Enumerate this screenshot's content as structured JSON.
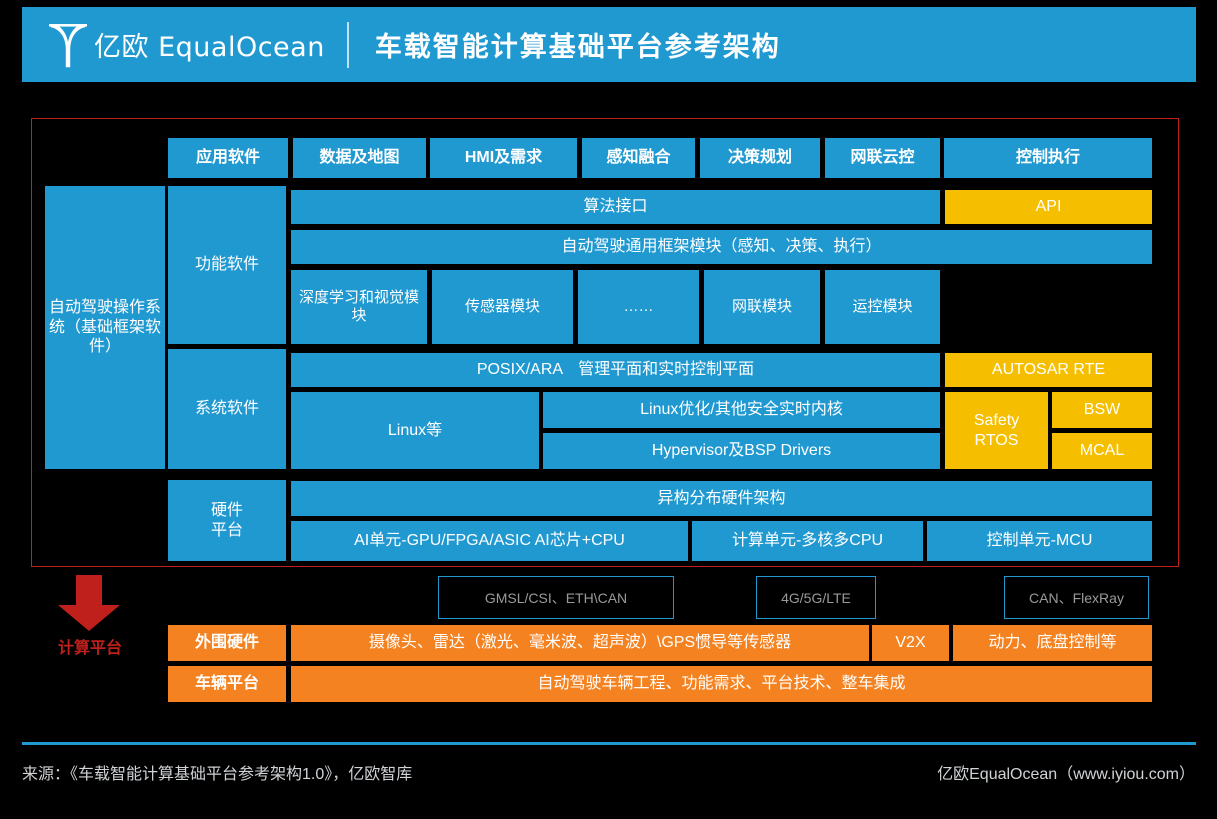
{
  "header": {
    "logo_text": "亿欧 EqualOcean",
    "logo_icon": "equalocean-leaf-logo",
    "title": "车载智能计算基础平台参考架构"
  },
  "top_row": [
    {
      "label": "应用软件"
    },
    {
      "label": "数据及地图"
    },
    {
      "label": "HMI及需求"
    },
    {
      "label": "感知融合"
    },
    {
      "label": "决策规划"
    },
    {
      "label": "网联云控"
    },
    {
      "label": "控制执行"
    }
  ],
  "left_column": {
    "label": "自动驾驶操作系统（基础框架软件）"
  },
  "layers": {
    "functional_software": "功能软件",
    "system_software": "系统软件",
    "hardware_platform": "硬件\n平台"
  },
  "functional": {
    "algorithm_interface": "算法接口",
    "api": "API",
    "general_framework": "自动驾驶通用框架模块（感知、决策、执行）",
    "modules": [
      {
        "label": "深度学习和视觉模块"
      },
      {
        "label": "传感器模块"
      },
      {
        "label": "……"
      },
      {
        "label": "网联模块"
      },
      {
        "label": "运控模块"
      }
    ]
  },
  "system": {
    "posix_ara": "POSIX/ARA　管理平面和实时控制平面",
    "autosar_rte": "AUTOSAR RTE",
    "linux": "Linux等",
    "linux_opt": "Linux优化/其他安全实时内核",
    "hypervisor": "Hypervisor及BSP Drivers",
    "safety_rtos": "Safety\nRTOS",
    "bsw": "BSW",
    "mcal": "MCAL"
  },
  "hardware": {
    "heterogeneous": "异构分布硬件架构",
    "units": [
      {
        "label": "AI单元-GPU/FPGA/ASIC AI芯片+CPU"
      },
      {
        "label": "计算单元-多核多CPU"
      },
      {
        "label": "控制单元-MCU"
      }
    ]
  },
  "connectors": [
    {
      "label": "GMSL/CSI、ETH\\CAN"
    },
    {
      "label": "4G/5G/LTE"
    },
    {
      "label": "CAN、FlexRay"
    }
  ],
  "compute_platform_arrow": {
    "label": "计算平台"
  },
  "bottom_rows": {
    "peripheral_label": "外围硬件",
    "peripheral_items": [
      {
        "label": "摄像头、雷达（激光、毫米波、超声波）\\GPS惯导等传感器"
      },
      {
        "label": "V2X"
      },
      {
        "label": "动力、底盘控制等"
      }
    ],
    "vehicle_label": "车辆平台",
    "vehicle_item": "自动驾驶车辆工程、功能需求、平台技术、整车集成"
  },
  "footer": {
    "source": "来源：《车载智能计算基础平台参考架构1.0》，亿欧智库",
    "brand": "亿欧EqualOcean（www.iyiou.com）"
  },
  "colors": {
    "blue": "#2099d1",
    "yellow": "#f5bf00",
    "orange": "#f58220",
    "red": "#c0201b",
    "background": "#000000"
  }
}
